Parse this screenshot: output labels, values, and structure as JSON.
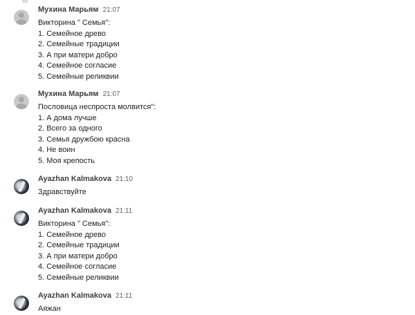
{
  "messages": [
    {
      "author": "Мухина Марьям",
      "time": "21:07",
      "avatar": "default-person-icon",
      "lines": [
        "Викторина \" Семья\":",
        "1. Семейное древо",
        "2. Семейные традиции",
        "3. А при матери добро",
        "4. Семейное согласие",
        "5. Семейные реликвии"
      ]
    },
    {
      "author": "Мухина Марьям",
      "time": "21:07",
      "avatar": "default-person-icon",
      "lines": [
        "Пословица неспроста молвится\":",
        "1. А дома лучше",
        "2. Всего за одного",
        "3. Семья дружбою красна",
        "4. Не воин",
        "5. Моя крепость"
      ]
    },
    {
      "author": "Ayazhan Kalmakova",
      "time": "21:10",
      "avatar": "profile-photo",
      "lines": [
        "Здравствуйте"
      ]
    },
    {
      "author": "Ayazhan Kalmakova",
      "time": "21:11",
      "avatar": "profile-photo",
      "lines": [
        "Викторина \" Семья\":",
        "1. Семейное древо",
        "2. Семейные традиции",
        "3. А при матери добро",
        "4. Семейное согласие",
        "5. Семейные реликвии"
      ]
    },
    {
      "author": "Ayazhan Kalmakova",
      "time": "21:11",
      "avatar": "profile-photo",
      "lines": [
        "Аяжан"
      ]
    }
  ]
}
